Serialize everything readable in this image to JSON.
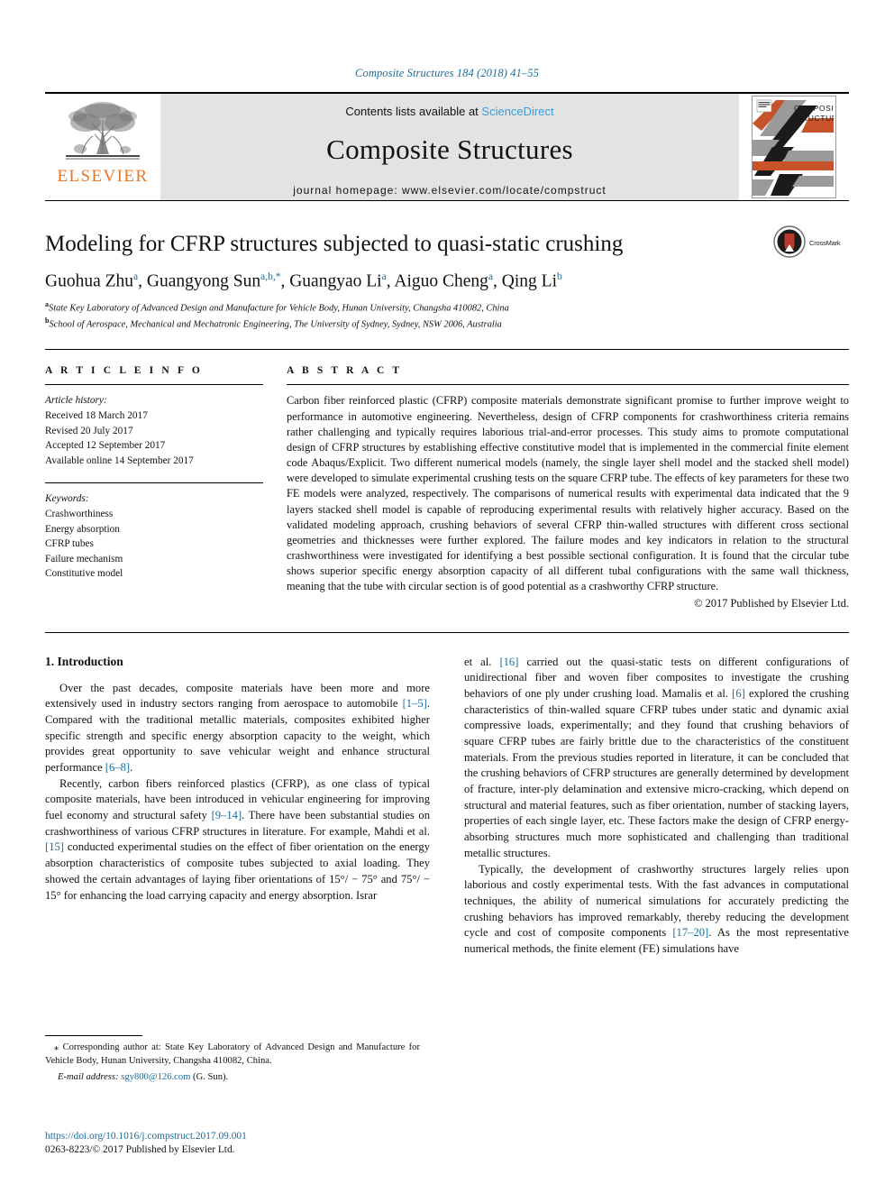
{
  "running_head": "Composite Structures 184 (2018) 41–55",
  "masthead": {
    "publisher_name": "ELSEVIER",
    "contents_prefix": "Contents lists available at ",
    "sciencedirect": "ScienceDirect",
    "journal_name": "Composite Structures",
    "homepage": "journal homepage: www.elsevier.com/locate/compstruct",
    "cover_title_line1": "COMPOSITE",
    "cover_title_line2": "STRUCTURES",
    "colors": {
      "link_blue": "#3C9CD7",
      "elsevier_orange": "#E87722",
      "running_head_blue": "#1a6b9c",
      "masthead_gray": "#e3e3e3"
    }
  },
  "article": {
    "title": "Modeling for CFRP structures subjected to quasi-static crushing",
    "crossmark_label": "CrossMark",
    "authors": [
      {
        "name": "Guohua Zhu",
        "sup": "a",
        "sep": ", "
      },
      {
        "name": "Guangyong Sun",
        "sup": "a,b,*",
        "sep": ", "
      },
      {
        "name": "Guangyao Li",
        "sup": "a",
        "sep": ", "
      },
      {
        "name": "Aiguo Cheng",
        "sup": "a",
        "sep": ", "
      },
      {
        "name": "Qing Li",
        "sup": "b",
        "sep": ""
      }
    ],
    "affiliations": [
      {
        "marker": "a",
        "text": "State Key Laboratory of Advanced Design and Manufacture for Vehicle Body, Hunan University, Changsha 410082, China"
      },
      {
        "marker": "b",
        "text": "School of Aerospace, Mechanical and Mechatronic Engineering, The University of Sydney, Sydney, NSW 2006, Australia"
      }
    ]
  },
  "article_info": {
    "heading": "A R T I C L E  I N F O",
    "history_label": "Article history:",
    "history": [
      "Received 18 March 2017",
      "Revised 20 July 2017",
      "Accepted 12 September 2017",
      "Available online 14 September 2017"
    ],
    "keywords_label": "Keywords:",
    "keywords": [
      "Crashworthiness",
      "Energy absorption",
      "CFRP tubes",
      "Failure mechanism",
      "Constitutive model"
    ]
  },
  "abstract": {
    "heading": "A B S T R A C T",
    "text": "Carbon fiber reinforced plastic (CFRP) composite materials demonstrate significant promise to further improve weight to performance in automotive engineering. Nevertheless, design of CFRP components for crashworthiness criteria remains rather challenging and typically requires laborious trial-and-error processes. This study aims to promote computational design of CFRP structures by establishing effective constitutive model that is implemented in the commercial finite element code Abaqus/Explicit. Two different numerical models (namely, the single layer shell model and the stacked shell model) were developed to simulate experimental crushing tests on the square CFRP tube. The effects of key parameters for these two FE models were analyzed, respectively. The comparisons of numerical results with experimental data indicated that the 9 layers stacked shell model is capable of reproducing experimental results with relatively higher accuracy. Based on the validated modeling approach, crushing behaviors of several CFRP thin-walled structures with different cross sectional geometries and thicknesses were further explored. The failure modes and key indicators in relation to the structural crashworthiness were investigated for identifying a best possible sectional configuration. It is found that the circular tube shows superior specific energy absorption capacity of all different tubal configurations with the same wall thickness, meaning that the tube with circular section is of good potential as a crashworthy CFRP structure.",
    "copyright": "© 2017 Published by Elsevier Ltd."
  },
  "body": {
    "section_title": "1. Introduction",
    "left_column": [
      {
        "segments": [
          {
            "t": "Over the past decades, composite materials have been more and more extensively used in industry sectors ranging from aerospace to automobile "
          },
          {
            "t": "[1–5]",
            "cit": true
          },
          {
            "t": ". Compared with the traditional metallic materials, composites exhibited higher specific strength and specific energy absorption capacity to the weight, which provides great opportunity to save vehicular weight and enhance structural performance "
          },
          {
            "t": "[6–8]",
            "cit": true
          },
          {
            "t": "."
          }
        ]
      },
      {
        "segments": [
          {
            "t": "Recently, carbon fibers reinforced plastics (CFRP), as one class of typical composite materials, have been introduced in vehicular engineering for improving fuel economy and structural safety "
          },
          {
            "t": "[9–14]",
            "cit": true
          },
          {
            "t": ". There have been substantial studies on crashworthiness of various CFRP structures in literature. For example, Mahdi et al. "
          },
          {
            "t": "[15]",
            "cit": true
          },
          {
            "t": " conducted experimental studies on the effect of fiber orientation on the energy absorption characteristics of composite tubes subjected to axial loading. They showed the certain advantages of laying fiber orientations of 15°/ − 75° and 75°/ − 15° for enhancing the load carrying capacity and energy absorption. Israr"
          }
        ]
      }
    ],
    "right_column": [
      {
        "segments": [
          {
            "t": "et al. "
          },
          {
            "t": "[16]",
            "cit": true
          },
          {
            "t": " carried out the quasi-static tests on different configurations of unidirectional fiber and woven fiber composites to investigate the crushing behaviors of one ply under crushing load. Mamalis et al. "
          },
          {
            "t": "[6]",
            "cit": true
          },
          {
            "t": " explored the crushing characteristics of thin-walled square CFRP tubes under static and dynamic axial compressive loads, experimentally; and they found that crushing behaviors of square CFRP tubes are fairly brittle due to the characteristics of the constituent materials. From the previous studies reported in literature, it can be concluded that the crushing behaviors of CFRP structures are generally determined by development of fracture, inter-ply delamination and extensive micro-cracking, which depend on structural and material features, such as fiber orientation, number of stacking layers, properties of each single layer, etc. These factors make the design of CFRP energy-absorbing structures much more sophisticated and challenging than traditional metallic structures."
          }
        ],
        "noindent": true
      },
      {
        "segments": [
          {
            "t": "Typically, the development of crashworthy structures largely relies upon laborious and costly experimental tests. With the fast advances in computational techniques, the ability of numerical simulations for accurately predicting the crushing behaviors has improved remarkably, thereby reducing the development cycle and cost of composite components "
          },
          {
            "t": "[17–20]",
            "cit": true
          },
          {
            "t": ". As the most representative numerical methods, the finite element (FE) simulations have"
          }
        ]
      }
    ]
  },
  "footnote": {
    "corresponding": "⁎ Corresponding author at: State Key Laboratory of Advanced Design and Manufacture for Vehicle Body, Hunan University, Changsha 410082, China.",
    "email_label": "E-mail address:",
    "email": "sgy800@126.com",
    "email_person": "(G. Sun)."
  },
  "footer": {
    "doi": "https://doi.org/10.1016/j.compstruct.2017.09.001",
    "issn": "0263-8223/© 2017 Published by Elsevier Ltd."
  }
}
